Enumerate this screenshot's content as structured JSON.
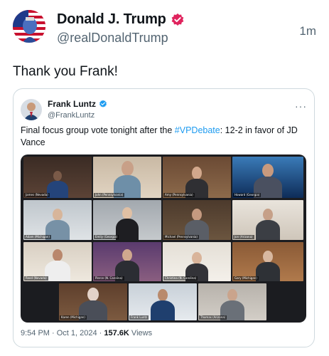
{
  "post": {
    "author_name": "Donald J. Trump",
    "author_handle": "@realDonaldTrump",
    "time": "1m",
    "text": "Thank you Frank!"
  },
  "quote": {
    "author_name": "Frank Luntz",
    "author_handle": "@FrankLuntz",
    "more_label": "···",
    "text_before": "Final focus group vote tonight after the ",
    "hashtag": "#VPDebate",
    "text_after": ": 12-2 in favor of JD Vance",
    "time": "9:54 PM · Oct 1, 2024 · ",
    "views_count": "157.6K",
    "views_label": " Views"
  },
  "video_tiles": [
    {
      "label": "James (Nevada)"
    },
    {
      "label": "John (Pennsylvania)"
    },
    {
      "label": "Amy (Pennsylvania)"
    },
    {
      "label": "Howard (Georgia)"
    },
    {
      "label": "Adam (Michigan)"
    },
    {
      "label": "Emily (Georgia)"
    },
    {
      "label": "Michael (Pennsylvania)"
    },
    {
      "label": "Jon (Arizona)"
    },
    {
      "label": "Reed (Nevada)"
    },
    {
      "label": "Pierce (N. Carolina)"
    },
    {
      "label": "Christina (N. Carolina)"
    },
    {
      "label": "Gary (Michigan)"
    },
    {
      "label": "Karen (Michigan)"
    },
    {
      "label": "Frank Luntz"
    },
    {
      "label": "Thomas (Arizona)"
    }
  ],
  "colors": {
    "verified_pink": "#e0245e",
    "verified_blue": "#1d9bf0",
    "hashtag": "#1d9bf0"
  }
}
